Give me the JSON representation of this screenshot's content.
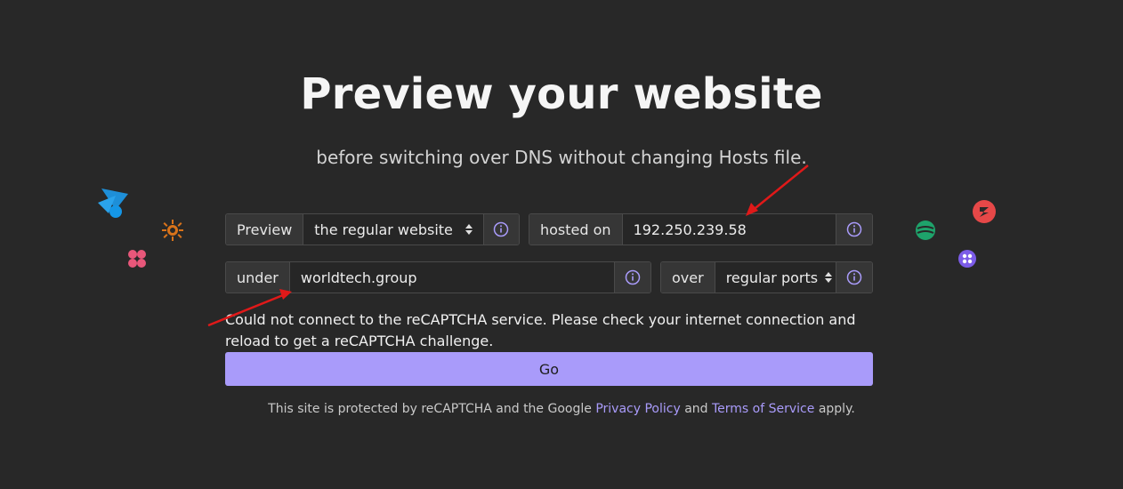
{
  "header": {
    "title": "Preview your website",
    "subtitle": "before switching over DNS without changing Hosts file."
  },
  "form": {
    "preview_label": "Preview",
    "preview_select": "the regular website",
    "hosted_label": "hosted on",
    "ip_value": "192.250.239.58",
    "under_label": "under",
    "domain_value": "worldtech.group",
    "over_label": "over",
    "ports_select": "regular ports",
    "go_label": "Go"
  },
  "recaptcha": {
    "message": "Could not connect to the reCAPTCHA service. Please check your internet connection and reload to get a reCAPTCHA challenge."
  },
  "footer": {
    "prefix": "This site is protected by reCAPTCHA and the Google",
    "privacy": "Privacy Policy",
    "and": "and",
    "terms": "Terms of Service",
    "suffix": "apply."
  },
  "colors": {
    "background": "#282828",
    "accent": "#a99bfa",
    "annotation_arrow": "#e01919"
  },
  "icons": {
    "info": "info-icon",
    "select_caret": "select-caret-icon"
  }
}
